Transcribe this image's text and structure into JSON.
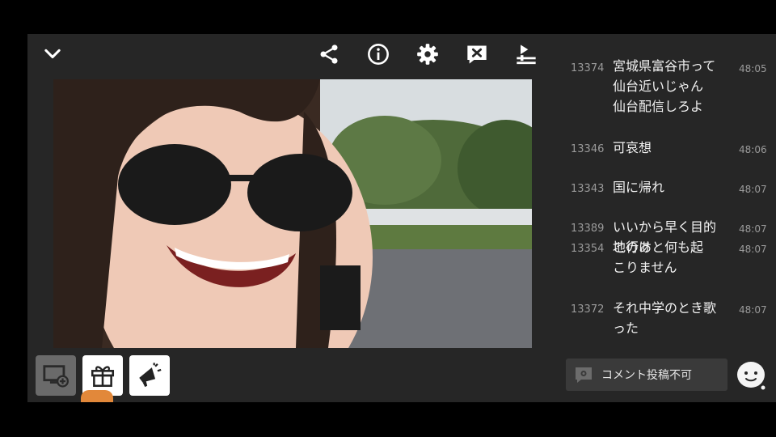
{
  "toolbar": {
    "icons": [
      "chevron-down-icon",
      "share-icon",
      "info-icon",
      "gear-icon",
      "comment-hide-icon",
      "quality-icon"
    ]
  },
  "comments": [
    {
      "num": "13374",
      "lines": [
        "宮城県富谷市って",
        "仙台近いじゃん",
        "仙台配信しろよ"
      ],
      "time": "48:05"
    },
    {
      "num": "13346",
      "lines": [
        "可哀想"
      ],
      "time": "48:06"
    },
    {
      "num": "13343",
      "lines": [
        "国に帰れ"
      ],
      "time": "48:07"
    },
    {
      "num": "13389",
      "lines": [
        "いいから早く目的",
        "地行け"
      ],
      "time": "48:07"
    },
    {
      "num": "13354",
      "lines": [
        "このあと何も起",
        "こりません"
      ],
      "time": "48:07"
    },
    {
      "num": "13372",
      "lines": [
        "それ中学のとき歌",
        "った"
      ],
      "time": "48:07"
    }
  ],
  "comment_box": {
    "label": "コメント投稿不可"
  },
  "bottom_icons": [
    "screen-add-icon",
    "gift-icon",
    "megaphone-icon"
  ],
  "colors": {
    "frame": "#262626",
    "panel_text": "#f2f2f2",
    "meta_text": "#9a9a9a",
    "button_white": "#ffffff",
    "button_gray": "#6a6a6a"
  }
}
